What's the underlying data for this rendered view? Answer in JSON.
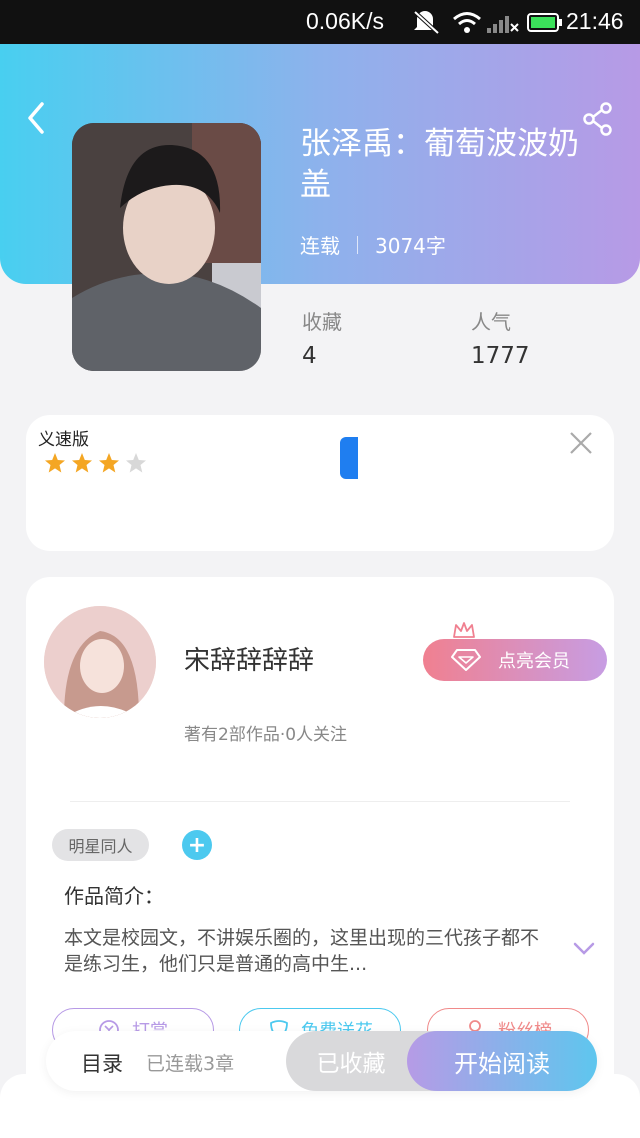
{
  "status_bar": {
    "speed": "0.06K/s",
    "time": "21:46"
  },
  "book": {
    "title": "张泽禹：葡萄波波奶盖",
    "status": "连载",
    "word_count": "3074字",
    "stats": [
      {
        "label": "收藏",
        "value": "4"
      },
      {
        "label": "人气",
        "value": "1777"
      }
    ]
  },
  "ad": {
    "title_fragment": "义速版",
    "rating_stars": 3,
    "rating_max": 4
  },
  "author": {
    "name": "宋辞辞辞辞",
    "meta": "著有2部作品·0人关注",
    "vip_button": "点亮会员"
  },
  "tags": [
    "明星同人"
  ],
  "intro": {
    "title": "作品简介：",
    "text": "本文是校园文，不讲娱乐圈的，这里出现的三代孩子都不是练习生，他们只是普通的高中生..."
  },
  "actions": [
    {
      "label": "打赏",
      "color": "#b79ae6"
    },
    {
      "label": "免费送花",
      "color": "#4cc9ef"
    },
    {
      "label": "粉丝榜",
      "color": "#f08a8a"
    }
  ],
  "bottom": {
    "toc_label": "目录",
    "toc_count": "已连载3章",
    "collected_button": "已收藏",
    "read_button": "开始阅读"
  }
}
